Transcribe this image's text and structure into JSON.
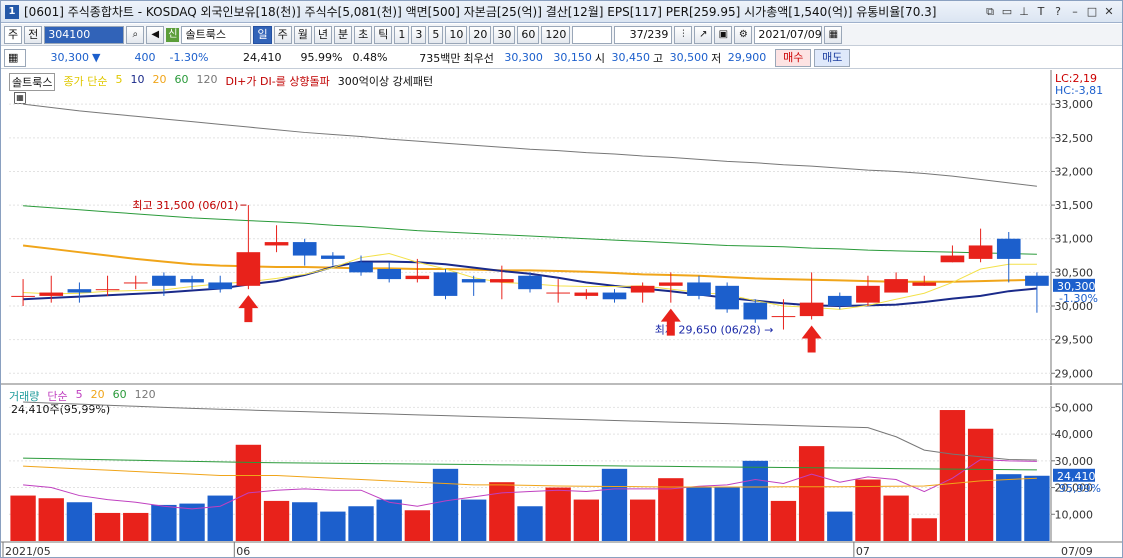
{
  "titlebar": {
    "number": "1",
    "text": "[0601] 주식종합차트 - KOSDAQ 외국인보유[18(천)] 주식수[5,081(천)] 액면[500] 자본금[25(억)] 결산[12월] EPS[117] PER[259.95] 시가총액[1,540(억)] 유통비율[70.3]"
  },
  "toolbar1": {
    "mode": "주",
    "prev": "전",
    "code": "304100",
    "stock_name": "솔트룩스",
    "periods": [
      "일",
      "주",
      "월",
      "년",
      "분",
      "초",
      "틱"
    ],
    "active_period": "일",
    "intervals": [
      "1",
      "3",
      "5",
      "10",
      "20",
      "30",
      "60",
      "120"
    ],
    "count": "37/239",
    "date": "2021/07/09"
  },
  "toolbar2": {
    "price": "30,300",
    "change": "400",
    "change_pct": "-1.30%",
    "volume": "24,410",
    "vol_ratio": "95.99%",
    "ratio2": "0.48%",
    "amount": "735백만",
    "best_label": "최우선",
    "best_ask": "30,300",
    "best_bid": "30,150",
    "open_label": "시",
    "open": "30,450",
    "high_label": "고",
    "high": "30,500",
    "low_label": "저",
    "low": "29,900",
    "buy": "매수",
    "sell": "매도"
  },
  "price_legend": {
    "name": "솔트룩스",
    "ma_label": "종가 단순",
    "ma": [
      "5",
      "10",
      "20",
      "60",
      "120"
    ],
    "cond1": "DI+가 DI-를 상향돌파",
    "cond2": "300억이상 강세패턴"
  },
  "price_right": {
    "lc": "LC:2,19",
    "hc": "HC:-3,81",
    "cur_price": "30,300",
    "cur_pct": "-1.30%"
  },
  "price_annot": {
    "high": "최고 31,500 (06/01)",
    "low": "최저 29,650 (06/28)"
  },
  "vol_legend": {
    "name": "거래량",
    "ma_label": "단순",
    "ma": [
      "5",
      "20",
      "60",
      "120"
    ],
    "info": "24,410주(95,99%)"
  },
  "vol_right": {
    "cur": "24,410",
    "pct": "95,99%"
  },
  "colors": {
    "up": "#e8221b",
    "down": "#1c5fcc",
    "ma5": "#f3e14a",
    "ma10": "#1a2a8a",
    "ma20": "#f0a51a",
    "ma60": "#2a9a3a",
    "ma120": "#777777",
    "vma5": "#c040c0",
    "vma20": "#f0a51a",
    "vma60": "#2a9a3a",
    "vma120": "#777777"
  },
  "chart_data": [
    {
      "type": "candlestick",
      "title": "솔트룩스 일봉",
      "ylim": [
        28900,
        33300
      ],
      "y_ticks": [
        29000,
        29500,
        30000,
        30500,
        31000,
        31500,
        32000,
        32500,
        33000
      ],
      "x_labels": [
        "2021/05",
        "06",
        "07",
        "07/09"
      ],
      "candles": [
        {
          "o": 30150,
          "c": 30150,
          "h": 30400,
          "l": 30000
        },
        {
          "o": 30150,
          "c": 30200,
          "h": 30450,
          "l": 30050
        },
        {
          "o": 30250,
          "c": 30200,
          "h": 30350,
          "l": 30050
        },
        {
          "o": 30250,
          "c": 30250,
          "h": 30450,
          "l": 30150
        },
        {
          "o": 30350,
          "c": 30350,
          "h": 30450,
          "l": 30250
        },
        {
          "o": 30450,
          "c": 30300,
          "h": 30500,
          "l": 30150
        },
        {
          "o": 30400,
          "c": 30350,
          "h": 30450,
          "l": 30250
        },
        {
          "o": 30350,
          "c": 30250,
          "h": 30450,
          "l": 30200
        },
        {
          "o": 30300,
          "c": 30800,
          "h": 31500,
          "l": 30250
        },
        {
          "o": 30900,
          "c": 30950,
          "h": 31200,
          "l": 30800
        },
        {
          "o": 30950,
          "c": 30750,
          "h": 31000,
          "l": 30600
        },
        {
          "o": 30750,
          "c": 30700,
          "h": 30800,
          "l": 30600
        },
        {
          "o": 30650,
          "c": 30500,
          "h": 30750,
          "l": 30450
        },
        {
          "o": 30550,
          "c": 30400,
          "h": 30650,
          "l": 30350
        },
        {
          "o": 30400,
          "c": 30450,
          "h": 30700,
          "l": 30350
        },
        {
          "o": 30500,
          "c": 30150,
          "h": 30550,
          "l": 30100
        },
        {
          "o": 30400,
          "c": 30350,
          "h": 30450,
          "l": 30150
        },
        {
          "o": 30350,
          "c": 30400,
          "h": 30600,
          "l": 30100
        },
        {
          "o": 30450,
          "c": 30250,
          "h": 30500,
          "l": 30200
        },
        {
          "o": 30200,
          "c": 30200,
          "h": 30400,
          "l": 30050
        },
        {
          "o": 30150,
          "c": 30200,
          "h": 30250,
          "l": 30100
        },
        {
          "o": 30200,
          "c": 30100,
          "h": 30250,
          "l": 30050
        },
        {
          "o": 30200,
          "c": 30300,
          "h": 30350,
          "l": 30050
        },
        {
          "o": 30300,
          "c": 30350,
          "h": 30500,
          "l": 30050
        },
        {
          "o": 30350,
          "c": 30150,
          "h": 30450,
          "l": 30100
        },
        {
          "o": 30300,
          "c": 29950,
          "h": 30350,
          "l": 29900
        },
        {
          "o": 30050,
          "c": 29800,
          "h": 30100,
          "l": 29750
        },
        {
          "o": 29850,
          "c": 29850,
          "h": 30100,
          "l": 29650
        },
        {
          "o": 29850,
          "c": 30050,
          "h": 30500,
          "l": 29800
        },
        {
          "o": 30150,
          "c": 30000,
          "h": 30200,
          "l": 29950
        },
        {
          "o": 30050,
          "c": 30300,
          "h": 30450,
          "l": 30000
        },
        {
          "o": 30200,
          "c": 30400,
          "h": 30500,
          "l": 30200
        },
        {
          "o": 30300,
          "c": 30350,
          "h": 30450,
          "l": 30300
        },
        {
          "o": 30650,
          "c": 30750,
          "h": 30900,
          "l": 30650
        },
        {
          "o": 30700,
          "c": 30900,
          "h": 31150,
          "l": 30650
        },
        {
          "o": 31000,
          "c": 30700,
          "h": 31100,
          "l": 30350
        },
        {
          "o": 30450,
          "c": 30300,
          "h": 30500,
          "l": 29900
        }
      ],
      "series": [
        {
          "name": "5",
          "values": [
            30200,
            30180,
            30190,
            30220,
            30230,
            30240,
            30290,
            30330,
            30360,
            30410,
            30470,
            30570,
            30720,
            30780,
            30650,
            30550,
            30420,
            30350,
            30330,
            30300,
            30290,
            30290,
            30300,
            30250,
            30200,
            30170,
            30080,
            30000,
            29980,
            29950,
            30010,
            30100,
            30190,
            30350,
            30550,
            30620,
            30620
          ]
        },
        {
          "name": "10",
          "values": [
            30100,
            30120,
            30140,
            30160,
            30180,
            30200,
            30230,
            30260,
            30320,
            30370,
            30460,
            30580,
            30660,
            30660,
            30650,
            30620,
            30570,
            30520,
            30480,
            30420,
            30350,
            30300,
            30260,
            30220,
            30170,
            30120,
            30080,
            30040,
            30010,
            30000,
            30010,
            30020,
            30060,
            30110,
            30150,
            30220,
            30260
          ]
        },
        {
          "name": "20",
          "values": [
            30900,
            30850,
            30800,
            30750,
            30700,
            30660,
            30620,
            30600,
            30590,
            30580,
            30580,
            30570,
            30560,
            30560,
            30550,
            30550,
            30540,
            30530,
            30530,
            30520,
            30510,
            30490,
            30470,
            30460,
            30450,
            30430,
            30410,
            30400,
            30390,
            30380,
            30370,
            30360,
            30360,
            30360,
            30370,
            30380,
            30390
          ]
        },
        {
          "name": "60",
          "values": [
            31490,
            31460,
            31430,
            31400,
            31370,
            31340,
            31310,
            31290,
            31270,
            31250,
            31230,
            31200,
            31180,
            31150,
            31120,
            31100,
            31080,
            31060,
            31040,
            31020,
            31000,
            30980,
            30960,
            30940,
            30920,
            30900,
            30890,
            30880,
            30860,
            30850,
            30830,
            30820,
            30810,
            30800,
            30790,
            30780,
            30770
          ]
        },
        {
          "name": "120",
          "values": [
            33000,
            32950,
            32900,
            32860,
            32820,
            32780,
            32740,
            32700,
            32660,
            32620,
            32580,
            32550,
            32520,
            32480,
            32450,
            32420,
            32390,
            32360,
            32330,
            32310,
            32280,
            32260,
            32230,
            32210,
            32180,
            32150,
            32130,
            32100,
            32080,
            32050,
            32020,
            32000,
            31970,
            31930,
            31880,
            31830,
            31780
          ]
        }
      ]
    },
    {
      "type": "bar",
      "title": "거래량",
      "ylim": [
        0,
        55000
      ],
      "y_ticks": [
        10000,
        20000,
        30000,
        40000,
        50000
      ],
      "values": [
        17000,
        16000,
        14500,
        10500,
        10500,
        13500,
        14000,
        17000,
        36000,
        15000,
        14500,
        11000,
        13000,
        15500,
        11500,
        27000,
        15500,
        22000,
        13000,
        20000,
        15500,
        27000,
        15500,
        23500,
        20000,
        20000,
        30000,
        15000,
        35500,
        11000,
        23000,
        17000,
        8500,
        49000,
        42000,
        25000,
        24410
      ],
      "series": [
        {
          "name": "5",
          "values": [
            21000,
            20000,
            17000,
            15500,
            14500,
            13000,
            12000,
            13000,
            18000,
            19000,
            19500,
            19000,
            19000,
            14500,
            13000,
            15000,
            16500,
            18000,
            18500,
            19000,
            18500,
            19500,
            19500,
            19500,
            20500,
            21000,
            23000,
            21500,
            25000,
            22000,
            24000,
            23000,
            18500,
            23500,
            30500,
            30000,
            29800
          ]
        },
        {
          "name": "20",
          "values": [
            28000,
            27500,
            27000,
            26500,
            26000,
            25500,
            25000,
            24500,
            24500,
            24500,
            24000,
            23500,
            23000,
            22500,
            22000,
            21500,
            21000,
            21000,
            20800,
            20600,
            20500,
            20400,
            20300,
            20200,
            20200,
            20200,
            20200,
            20300,
            20300,
            20300,
            20400,
            20500,
            20600,
            21500,
            22500,
            23000,
            23500
          ]
        },
        {
          "name": "60",
          "values": [
            31000,
            30800,
            30600,
            30400,
            30200,
            30000,
            29800,
            29600,
            29400,
            29300,
            29200,
            29100,
            29000,
            28900,
            28800,
            28700,
            28600,
            28500,
            28400,
            28300,
            28200,
            28100,
            28000,
            27900,
            27800,
            27700,
            27600,
            27500,
            27400,
            27300,
            27200,
            27100,
            27000,
            26900,
            26800,
            26700,
            26600
          ]
        },
        {
          "name": "120",
          "values": [
            52000,
            51600,
            51200,
            50800,
            50400,
            50000,
            49600,
            49300,
            49000,
            48700,
            48400,
            48100,
            47800,
            47500,
            47200,
            46900,
            46600,
            46300,
            46000,
            45700,
            45400,
            45100,
            44800,
            44500,
            44200,
            43900,
            43600,
            43300,
            43000,
            42700,
            42400,
            39000,
            34000,
            32500,
            31500,
            30500,
            30300
          ]
        }
      ]
    }
  ]
}
